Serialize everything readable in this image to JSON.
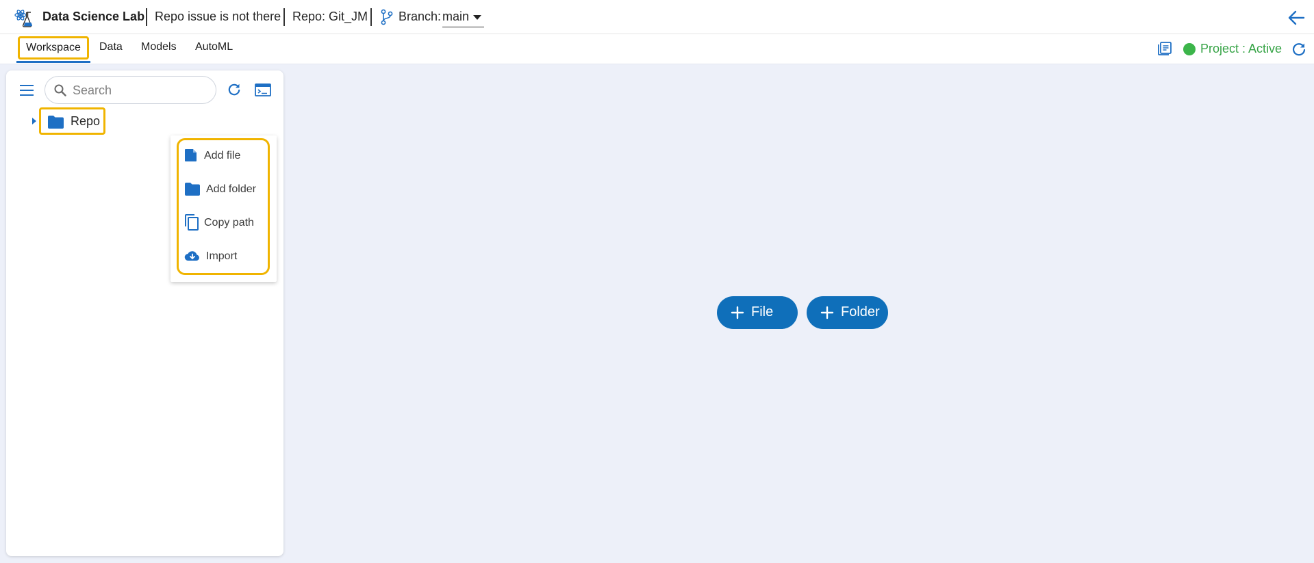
{
  "header": {
    "app_title": "Data Science Lab",
    "project_name": "Repo issue is not there",
    "repo_label": "Repo: Git_JM",
    "branch_label": "Branch:",
    "branch_value": "main"
  },
  "tabs": [
    {
      "label": "Workspace",
      "active": true
    },
    {
      "label": "Data",
      "active": false
    },
    {
      "label": "Models",
      "active": false
    },
    {
      "label": "AutoML",
      "active": false
    }
  ],
  "project_status": {
    "text": "Project : Active",
    "color": "#35a345"
  },
  "sidebar": {
    "search_placeholder": "Search",
    "tree": [
      {
        "label": "Repo",
        "type": "folder",
        "expanded": false
      }
    ]
  },
  "context_menu": {
    "items": [
      {
        "label": "Add file",
        "icon": "add-file-icon"
      },
      {
        "label": "Add folder",
        "icon": "folder-icon"
      },
      {
        "label": "Copy path",
        "icon": "copy-icon"
      },
      {
        "label": "Import",
        "icon": "cloud-download-icon"
      }
    ]
  },
  "actions": {
    "add_file_label": "File",
    "add_folder_label": "Folder"
  },
  "colors": {
    "accent": "#1e6fc4",
    "button": "#0f6fba",
    "highlight": "#f0b400",
    "background": "#edf0f9"
  }
}
